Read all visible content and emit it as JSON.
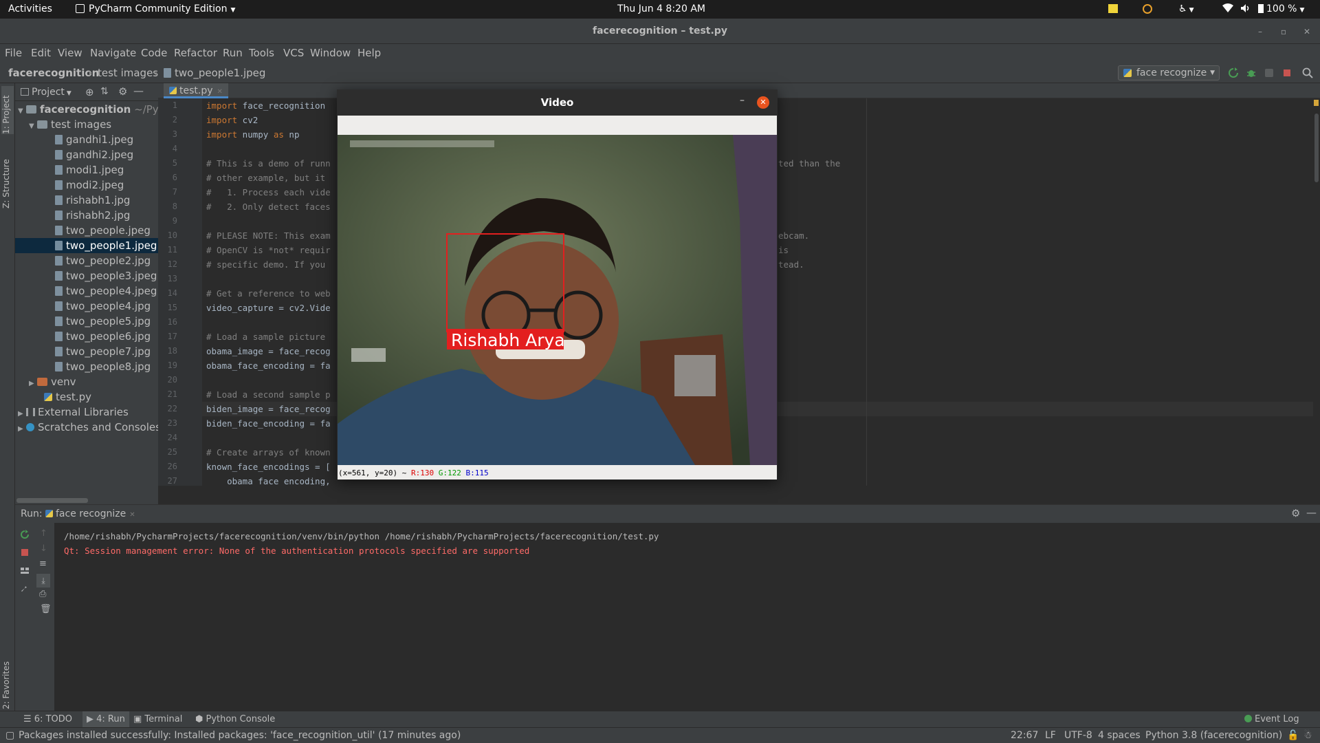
{
  "topbar": {
    "activities": "Activities",
    "app_name": "PyCharm Community Edition",
    "clock": "Thu Jun 4   8:20 AM",
    "battery": "100 %"
  },
  "window": {
    "title": "facerecognition – test.py"
  },
  "menu": [
    "File",
    "Edit",
    "View",
    "Navigate",
    "Code",
    "Refactor",
    "Run",
    "Tools",
    "VCS",
    "Window",
    "Help"
  ],
  "breadcrumb": {
    "project": "facerecognition",
    "folder": "test images",
    "file": "two_people1.jpeg"
  },
  "run_config": {
    "name": "face recognize"
  },
  "left_stripe": {
    "project": "1: Project",
    "structure": "Z: Structure",
    "favorites": "2: Favorites"
  },
  "project_panel": {
    "header": "Project",
    "root_name": "facerecognition",
    "root_path": "~/Pycha",
    "test_folder": "test images",
    "files": [
      "gandhi1.jpeg",
      "gandhi2.jpeg",
      "modi1.jpeg",
      "modi2.jpeg",
      "rishabh1.jpg",
      "rishabh2.jpg",
      "two_people.jpeg",
      "two_people1.jpeg",
      "two_people2.jpg",
      "two_people3.jpeg",
      "two_people4.jpeg",
      "two_people4.jpg",
      "two_people5.jpg",
      "two_people6.jpg",
      "two_people7.jpg",
      "two_people8.jpg"
    ],
    "selected_file": "two_people1.jpeg",
    "venv": "venv",
    "test_py": "test.py",
    "external": "External Libraries",
    "scratches": "Scratches and Consoles"
  },
  "editor": {
    "tab": "test.py",
    "lines": [
      {
        "n": "1",
        "text": "import face_recognition"
      },
      {
        "n": "2",
        "text": "import cv2"
      },
      {
        "n": "3",
        "text": "import numpy as np"
      },
      {
        "n": "4",
        "text": ""
      },
      {
        "n": "5",
        "text": "# This is a demo of runn"
      },
      {
        "n": "6",
        "text": "# other example, but it"
      },
      {
        "n": "7",
        "text": "#   1. Process each vide"
      },
      {
        "n": "8",
        "text": "#   2. Only detect faces"
      },
      {
        "n": "9",
        "text": ""
      },
      {
        "n": "10",
        "text": "# PLEASE NOTE: This exam"
      },
      {
        "n": "11",
        "text": "# OpenCV is *not* requir"
      },
      {
        "n": "12",
        "text": "# specific demo. If you"
      },
      {
        "n": "13",
        "text": ""
      },
      {
        "n": "14",
        "text": "# Get a reference to web"
      },
      {
        "n": "15",
        "text": "video_capture = cv2.Vide"
      },
      {
        "n": "16",
        "text": ""
      },
      {
        "n": "17",
        "text": "# Load a sample picture"
      },
      {
        "n": "18",
        "text": "obama_image = face_recog"
      },
      {
        "n": "19",
        "text": "obama_face_encoding = fa"
      },
      {
        "n": "20",
        "text": ""
      },
      {
        "n": "21",
        "text": "# Load a second sample p"
      },
      {
        "n": "22",
        "text": "biden_image = face_recog"
      },
      {
        "n": "23",
        "text": "biden_face_encoding = fa"
      },
      {
        "n": "24",
        "text": ""
      },
      {
        "n": "25",
        "text": "# Create arrays of known"
      },
      {
        "n": "26",
        "text": "known_face_encodings = ["
      },
      {
        "n": "27",
        "text": "    obama_face_encoding,"
      }
    ],
    "right_fragments": [
      {
        "line": "5",
        "text": "ted than the"
      },
      {
        "line": "10",
        "text": "ebcam."
      },
      {
        "line": "11",
        "text": "is"
      },
      {
        "line": "12",
        "text": "tead."
      }
    ]
  },
  "video_window": {
    "title": "Video",
    "label": "Rishabh Arya",
    "status_coords": "(x=561, y=20) ~ ",
    "status_r": "R:130",
    "status_g": "G:122",
    "status_b": "B:115"
  },
  "run_panel": {
    "label": "Run:",
    "tab": "face recognize",
    "output_cmd": "/home/rishabh/PycharmProjects/facerecognition/venv/bin/python /home/rishabh/PycharmProjects/facerecognition/test.py",
    "output_err": "Qt: Session management error: None of the authentication protocols specified are supported"
  },
  "bottom_tools": {
    "todo": "6: TODO",
    "run": "4: Run",
    "terminal": "Terminal",
    "python_console": "Python Console",
    "event_log": "Event Log"
  },
  "status_bar": {
    "message": "Packages installed successfully: Installed packages: 'face_recognition_util' (17 minutes ago)",
    "position": "22:67",
    "line_sep": "LF",
    "encoding": "UTF-8",
    "indent": "4 spaces",
    "interpreter": "Python 3.8 (facerecognition)"
  },
  "colors": {
    "accent_run": "#499c54",
    "stop_red": "#c75450",
    "error_text": "#ff6b68",
    "selection": "#0d293e",
    "face_box": "#e31f1f"
  }
}
